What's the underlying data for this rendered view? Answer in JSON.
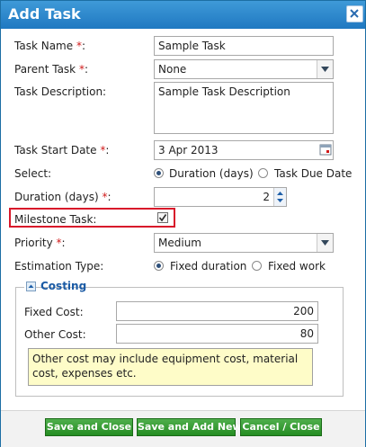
{
  "dialog": {
    "title": "Add Task"
  },
  "form": {
    "task_name": {
      "label": "Task Name ",
      "required": "*",
      "colon": ":",
      "value": "Sample Task"
    },
    "parent_task": {
      "label": "Parent Task ",
      "required": "*",
      "colon": ":",
      "value": "None"
    },
    "task_description": {
      "label": "Task Description:",
      "value": "Sample Task Description"
    },
    "task_start_date": {
      "label": "Task Start Date ",
      "required": "*",
      "colon": ":",
      "value": "3 Apr 2013"
    },
    "select": {
      "label": "Select:",
      "option_duration": "Duration (days)",
      "option_due_date": "Task Due Date",
      "selected": "Duration (days)"
    },
    "duration": {
      "label": "Duration (days) ",
      "required": "*",
      "colon": ":",
      "value": "2"
    },
    "milestone": {
      "label": "Milestone Task:",
      "checked": true
    },
    "priority": {
      "label": "Priority ",
      "required": "*",
      "colon": ":",
      "value": "Medium"
    },
    "estimation_type": {
      "label": "Estimation Type:",
      "option_fixed_duration": "Fixed duration",
      "option_fixed_work": "Fixed work",
      "selected": "Fixed duration"
    }
  },
  "costing": {
    "legend": "Costing",
    "fixed_cost": {
      "label": "Fixed Cost:",
      "value": "200"
    },
    "other_cost": {
      "label": "Other Cost:",
      "value": "80"
    },
    "note": "Other cost may include equipment cost, material cost, expenses etc."
  },
  "buttons": {
    "save_close": "Save and Close",
    "save_add_new": "Save and Add New",
    "cancel_close": "Cancel / Close"
  },
  "colors": {
    "title_bar": "#2a86cc",
    "button": "#37a034",
    "required": "#d01a1a",
    "highlight": "#d8172a",
    "note_bg": "#fefcc8"
  },
  "icons": {
    "close": "close-icon",
    "dropdown": "chevron-down-icon",
    "calendar": "calendar-icon",
    "stepper": "spinner-icon",
    "collapse": "collapse-icon"
  }
}
